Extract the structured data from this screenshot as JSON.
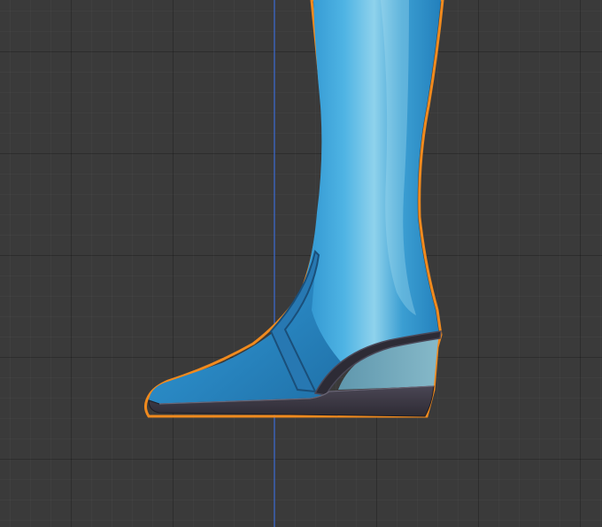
{
  "viewport": {
    "background": "#3a3a3a",
    "grid_major": "#2b2b2b",
    "axis_color": "#3f6fd8"
  },
  "model": {
    "object": "boot-mesh",
    "selected": true,
    "selection_outline_color": "#f08a1e",
    "material_color": "#2e8fc8",
    "sole_color": "#3e3a44",
    "heel_color": "#6fa4b8"
  }
}
